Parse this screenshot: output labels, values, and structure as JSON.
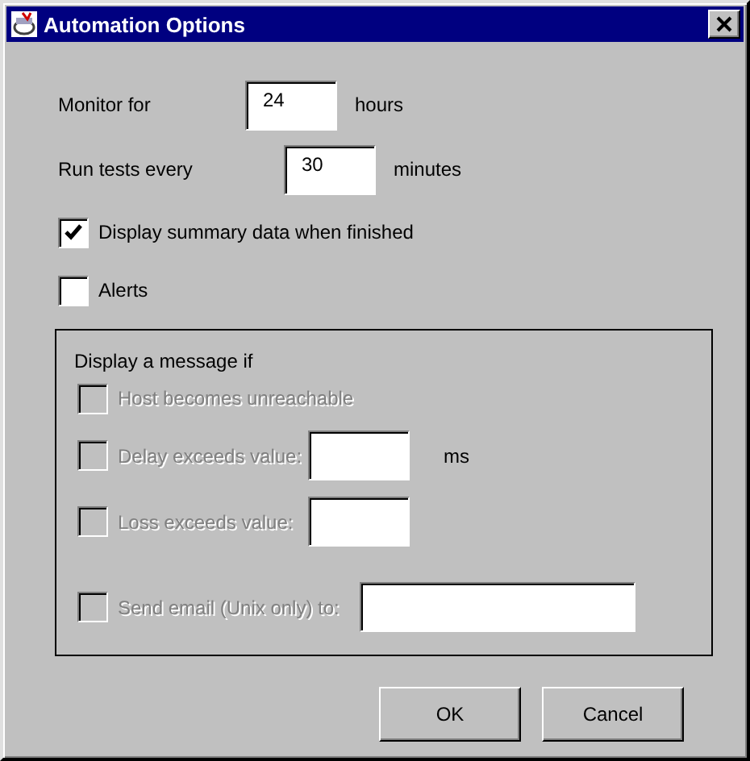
{
  "window": {
    "title": "Automation Options"
  },
  "fields": [
    {
      "label": "Monitor for",
      "value": "24",
      "unit": "hours"
    },
    {
      "label": "Run tests every",
      "value": "30",
      "unit": "minutes"
    }
  ],
  "options": [
    {
      "label": "Display summary data when finished",
      "checked": true
    },
    {
      "label": "Alerts",
      "checked": false
    }
  ],
  "message_group": {
    "title": "Display a message if",
    "conditions": [
      {
        "kind": "check",
        "label": "Host becomes unreachable",
        "checked": false,
        "disabled": true
      },
      {
        "kind": "value",
        "label": "Delay exceeds value:",
        "unit": "ms",
        "checked": false,
        "disabled": true
      },
      {
        "kind": "value",
        "label": "Loss exceeds value:",
        "checked": false,
        "disabled": true
      },
      {
        "kind": "wide",
        "label": "Send email (Unix only) to:",
        "checked": false,
        "disabled": true
      }
    ]
  },
  "buttons": [
    "OK",
    "Cancel"
  ]
}
